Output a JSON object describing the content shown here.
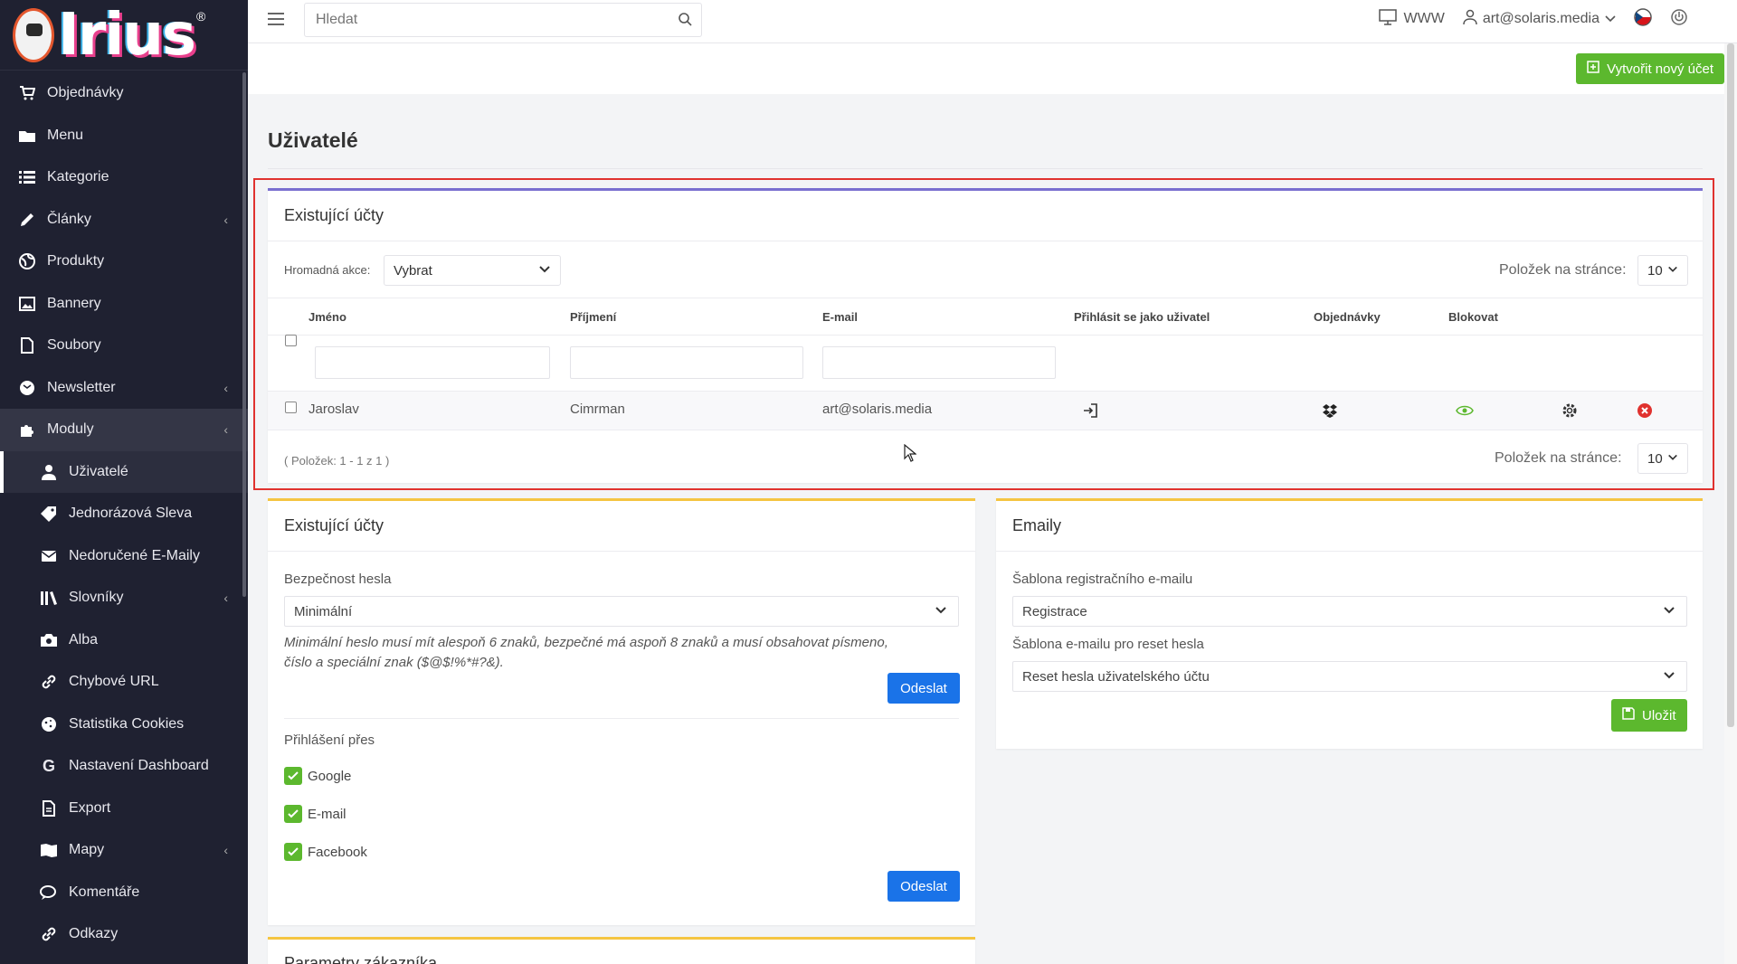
{
  "brand": {
    "logo_text": "Irius",
    "reg": "®"
  },
  "colors": {
    "sidebar": "#1f2131",
    "accent_green": "#5cb82e",
    "accent_blue": "#1a73e8",
    "danger": "#e0322f"
  },
  "sidebar": {
    "items": [
      {
        "label": "Objednávky",
        "icon": "cart-icon"
      },
      {
        "label": "Menu",
        "icon": "folder-icon"
      },
      {
        "label": "Kategorie",
        "icon": "list-icon"
      },
      {
        "label": "Články",
        "icon": "pencil-icon"
      },
      {
        "label": "Produkty",
        "icon": "globe-icon"
      },
      {
        "label": "Bannery",
        "icon": "image-icon"
      },
      {
        "label": "Soubory",
        "icon": "file-icon"
      },
      {
        "label": "Newsletter",
        "icon": "mail-icon"
      },
      {
        "label": "Moduly",
        "icon": "puzzle-icon"
      },
      {
        "label": "Uživatelé",
        "icon": "user-icon"
      },
      {
        "label": "Jednorázová Sleva",
        "icon": "tag-icon"
      },
      {
        "label": "Nedoručené E-Maily",
        "icon": "envelope-icon"
      },
      {
        "label": "Slovníky",
        "icon": "books-icon"
      },
      {
        "label": "Alba",
        "icon": "camera-icon"
      },
      {
        "label": "Chybové URL",
        "icon": "link-icon"
      },
      {
        "label": "Statistika Cookies",
        "icon": "cookie-icon"
      },
      {
        "label": "Nastavení Dashboard",
        "icon": "google-icon"
      },
      {
        "label": "Export",
        "icon": "document-icon"
      },
      {
        "label": "Mapy",
        "icon": "map-icon"
      },
      {
        "label": "Komentáře",
        "icon": "comments-icon"
      },
      {
        "label": "Odkazy",
        "icon": "link-icon"
      }
    ]
  },
  "topbar": {
    "search_placeholder": "Hledat",
    "www_label": "WWW",
    "user_email": "art@solaris.media"
  },
  "header": {
    "new_account_button": "Vytvořit nový účet",
    "page_title": "Uživatelé"
  },
  "accounts_table": {
    "title": "Existující účty",
    "bulk_label": "Hromadná akce:",
    "bulk_value": "Vybrat",
    "per_page_label": "Položek na stránce:",
    "per_page_value": "10",
    "columns": [
      "Jméno",
      "Příjmení",
      "E-mail",
      "Přihlásit se jako uživatel",
      "Objednávky",
      "Blokovat"
    ],
    "rows": [
      {
        "first_name": "Jaroslav",
        "last_name": "Cimrman",
        "email": "art@solaris.media"
      }
    ],
    "pager_text": "( Položek: 1 - 1 z 1 )"
  },
  "password_card": {
    "title": "Existující účty",
    "strength_label": "Bezpečnost hesla",
    "strength_value": "Minimální",
    "hint_line1": "Minimální heslo musí mít alespoň 6 znaků, bezpečné má aspoň 8 znaků a musí obsahovat písmeno,",
    "hint_line2": "číslo a speciální znak ($@$!%*#?&).",
    "send_button": "Odeslat",
    "login_via_label": "Přihlášení přes",
    "login_options": [
      "Google",
      "E-mail",
      "Facebook"
    ],
    "send_button_2": "Odeslat"
  },
  "emails_card": {
    "title": "Emaily",
    "registration_label": "Šablona registračního e-mailu",
    "registration_value": "Registrace",
    "reset_label": "Šablona e-mailu pro reset hesla",
    "reset_value": "Reset hesla uživatelského účtu",
    "save_button": "Uložit"
  },
  "customer_params_card": {
    "title": "Parametry zákazníka"
  }
}
